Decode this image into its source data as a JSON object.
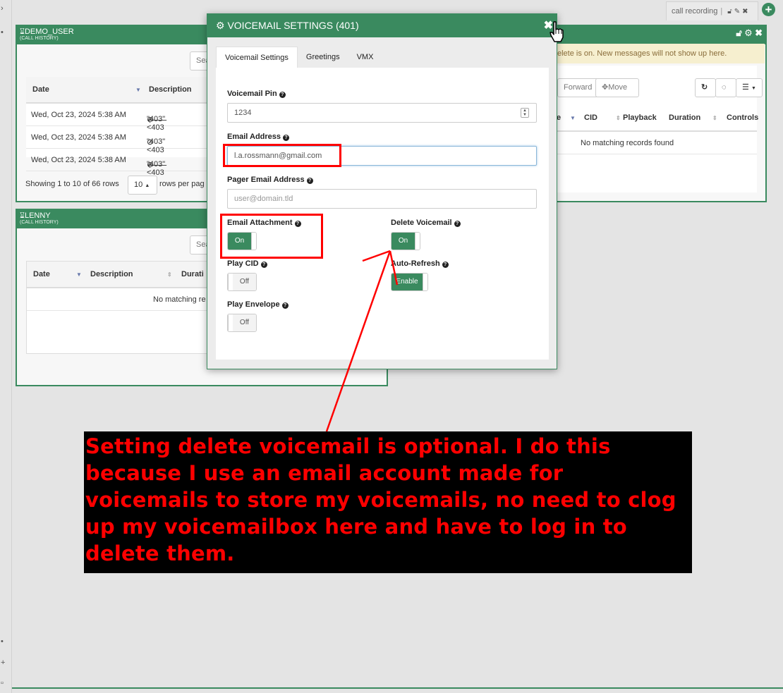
{
  "top_tab": {
    "label": "call recording"
  },
  "panel_demo": {
    "title": "DEMO_USER",
    "subtitle": "(CALL HISTORY)",
    "search_placeholder": "Sea",
    "columns": [
      "Date",
      "Description"
    ],
    "rows": [
      {
        "date": "Wed, Oct 23, 2024 5:38 AM",
        "desc": "\"403\" <403"
      },
      {
        "date": "Wed, Oct 23, 2024 5:38 AM",
        "desc": "\"403\" <403"
      },
      {
        "date": "Wed, Oct 23, 2024 5:38 AM",
        "desc": "\"403\" <403"
      }
    ],
    "showing": "Showing 1 to 10 of 66 rows",
    "page_size": "10",
    "rows_per_page": "rows per pag"
  },
  "panel_lenny": {
    "title": "LENNY",
    "subtitle": "(CALL HISTORY)",
    "search_placeholder": "Sea",
    "columns": [
      "Date",
      "Description",
      "Durati"
    ],
    "empty": "No matching re"
  },
  "panel_vm": {
    "notice": "elete is on. New messages will not show up here.",
    "forward": "Forward",
    "move": "Move",
    "columns": [
      "e",
      "CID",
      "Playback",
      "Duration",
      "Controls"
    ],
    "empty": "No matching records found"
  },
  "modal": {
    "title": "VOICEMAIL SETTINGS (401)",
    "tabs": [
      "Voicemail Settings",
      "Greetings",
      "VMX"
    ],
    "pin_label": "Voicemail Pin",
    "pin_value": "1234",
    "email_label": "Email Address",
    "email_value": "l.a.rossmann@gmail.com",
    "pager_label": "Pager Email Address",
    "pager_placeholder": "user@domain.tld",
    "attach_label": "Email Attachment",
    "attach_value": "On",
    "delete_label": "Delete Voicemail",
    "delete_value": "On",
    "playcid_label": "Play CID",
    "playcid_value": "Off",
    "autorefresh_label": "Auto-Refresh",
    "autorefresh_value": "Enable",
    "envelope_label": "Play Envelope",
    "envelope_value": "Off"
  },
  "caption": "Setting delete voicemail is optional. I do this because I use an email account made for voicemails to store my voicemails, no need to clog up my voicemailbox here and have to log in to delete them.",
  "colors": {
    "accent": "#3a8a5f",
    "annotation": "#ff0000"
  }
}
